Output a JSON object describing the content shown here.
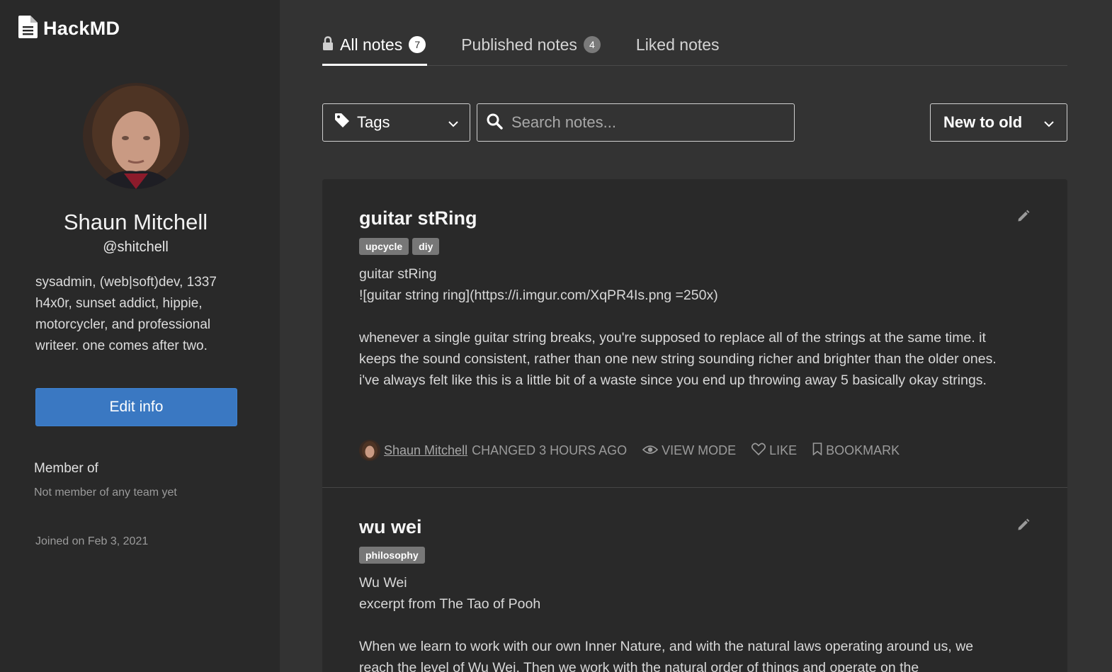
{
  "brand": {
    "name": "HackMD",
    "icon": "file-text-icon"
  },
  "profile": {
    "name": "Shaun Mitchell",
    "handle": "@shitchell",
    "bio": "sysadmin, (web|soft)dev, 1337 h4x0r, sunset addict, hippie, motorcycler, and professional writeer. one comes after two.",
    "edit_label": "Edit info",
    "member_label": "Member of",
    "member_value": "Not member of any team yet",
    "joined": "Joined on Feb 3, 2021"
  },
  "tabs": [
    {
      "label": "All notes",
      "count": "7",
      "icon": "lock-icon",
      "active": true
    },
    {
      "label": "Published notes",
      "count": "4",
      "active": false
    },
    {
      "label": "Liked notes",
      "active": false
    }
  ],
  "filters": {
    "tags_label": "Tags",
    "search_placeholder": "Search notes...",
    "sort_value": "New to old"
  },
  "notes": [
    {
      "title": "guitar stRing",
      "tags": [
        "upcycle",
        "diy"
      ],
      "lines": [
        "guitar stRing",
        "![guitar string ring](https://i.imgur.com/XqPR4Is.png =250x)",
        "",
        "whenever a single guitar string breaks, you're supposed to replace all of the strings at the same time. it keeps the sound consistent, rather than one new string sounding richer and brighter than the older ones. i've always felt like this is a little bit of a waste since you end up throwing away 5 basically okay strings."
      ],
      "author": "Shaun Mitchell",
      "changed": "CHANGED 3 HOURS AGO",
      "view_mode": "VIEW MODE",
      "like": "LIKE",
      "bookmark": "BOOKMARK"
    },
    {
      "title": "wu wei",
      "tags": [
        "philosophy"
      ],
      "lines": [
        "Wu Wei",
        "excerpt from The Tao of Pooh",
        "",
        "When we learn to work with our own Inner Nature, and with the natural laws operating around us, we reach the level of Wu Wei. Then we work with the natural order of things and operate on the"
      ]
    }
  ]
}
